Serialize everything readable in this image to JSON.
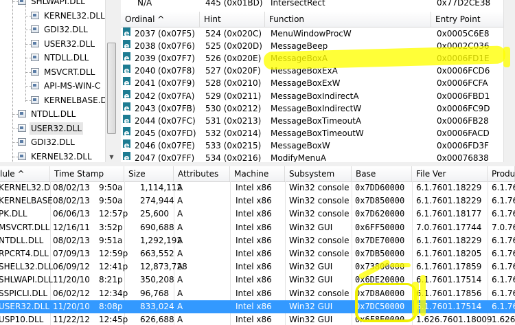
{
  "tree": {
    "nodes": [
      {
        "label": "SHLWAPI.DLL",
        "indent": 1
      },
      {
        "label": "KERNEL32.DLL",
        "indent": 2
      },
      {
        "label": "GDI32.DLL",
        "indent": 2
      },
      {
        "label": "USER32.DLL",
        "indent": 2
      },
      {
        "label": "NTDLL.DLL",
        "indent": 2
      },
      {
        "label": "MSVCRT.DLL",
        "indent": 2
      },
      {
        "label": "API-MS-WIN-C",
        "indent": 2
      },
      {
        "label": "KERNELBASE.D",
        "indent": 2
      },
      {
        "label": "NTDLL.DLL",
        "indent": 1
      },
      {
        "label": "USER32.DLL",
        "indent": 1,
        "selected": true
      },
      {
        "label": "GDI32.DLL",
        "indent": 1
      },
      {
        "label": "KERNEL32.DLL",
        "indent": 1
      }
    ]
  },
  "exports": {
    "top_row": {
      "ordinal": "N/A",
      "hint": "445 (0x01BD)",
      "function": "IntersectRect",
      "entry": "0x77D2CE38"
    },
    "columns": [
      "Ordinal ^",
      "Hint",
      "Function",
      "Entry Point"
    ],
    "rows": [
      {
        "ordinal": "2037",
        "ordinal_hex": "(0x07F5)",
        "hint": "524 (0x020C)",
        "function": "MenuWindowProcW",
        "entry": "0x0005C6E8"
      },
      {
        "ordinal": "2038",
        "ordinal_hex": "(0x07F6)",
        "hint": "525 (0x020D)",
        "function": "MessageBeep",
        "entry": "0x0002C036"
      },
      {
        "ordinal": "2039",
        "ordinal_hex": "(0x07F7)",
        "hint": "526 (0x020E)",
        "function": "MessageBoxA",
        "entry": "0x0006FD1E"
      },
      {
        "ordinal": "2040",
        "ordinal_hex": "(0x07F8)",
        "hint": "527 (0x020F)",
        "function": "MessageBoxExA",
        "entry": "0x0006FCD6"
      },
      {
        "ordinal": "2041",
        "ordinal_hex": "(0x07F9)",
        "hint": "528 (0x0210)",
        "function": "MessageBoxExW",
        "entry": "0x0006FCFA"
      },
      {
        "ordinal": "2042",
        "ordinal_hex": "(0x07FA)",
        "hint": "529 (0x0211)",
        "function": "MessageBoxIndirectA",
        "entry": "0x0006FBD1"
      },
      {
        "ordinal": "2043",
        "ordinal_hex": "(0x07FB)",
        "hint": "530 (0x0212)",
        "function": "MessageBoxIndirectW",
        "entry": "0x0006FC9D"
      },
      {
        "ordinal": "2044",
        "ordinal_hex": "(0x07FC)",
        "hint": "531 (0x0213)",
        "function": "MessageBoxTimeoutA",
        "entry": "0x0006FB28"
      },
      {
        "ordinal": "2045",
        "ordinal_hex": "(0x07FD)",
        "hint": "532 (0x0214)",
        "function": "MessageBoxTimeoutW",
        "entry": "0x0006FACD"
      },
      {
        "ordinal": "2046",
        "ordinal_hex": "(0x07FE)",
        "hint": "533 (0x0215)",
        "function": "MessageBoxW",
        "entry": "0x0006FD3F"
      },
      {
        "ordinal": "2047",
        "ordinal_hex": "(0x07FF)",
        "hint": "534 (0x0216)",
        "function": "ModifyMenuA",
        "entry": "0x00076838"
      }
    ]
  },
  "modules": {
    "columns": [
      "lule ^",
      "Time Stamp",
      "Size",
      "Attributes",
      "Machine",
      "Subsystem",
      "Base",
      "File Ver",
      "Produ"
    ],
    "rows": [
      {
        "module": "KERNEL32.D",
        "date": "08/02/13",
        "time": "9:50a",
        "size": "1,114,112",
        "attr": "A",
        "machine": "Intel x86",
        "subsystem": "Win32 console",
        "base": "0x7DD60000",
        "filever": "6.1.7601.18229",
        "prod": "6.1.76"
      },
      {
        "module": "KERNELBASE",
        "date": "08/02/13",
        "time": "9:50a",
        "size": "274,944",
        "attr": "A",
        "machine": "Intel x86",
        "subsystem": "Win32 console",
        "base": "0x7D850000",
        "filever": "6.1.7601.18229",
        "prod": "6.1.76"
      },
      {
        "module": "PK.DLL",
        "date": "06/06/13",
        "time": "12:57p",
        "size": "25,600",
        "attr": "A",
        "machine": "Intel x86",
        "subsystem": "Win32 console",
        "base": "0x7D620000",
        "filever": "6.1.7601.18177",
        "prod": "6.1.76"
      },
      {
        "module": "MSVCRT.DLL",
        "date": "12/16/11",
        "time": "3:52p",
        "size": "690,688",
        "attr": "A",
        "machine": "Intel x86",
        "subsystem": "Win32 GUI",
        "base": "0x6FF50000",
        "filever": "7.0.7601.17744",
        "prod": "7.0.76"
      },
      {
        "module": "NTDLL.DLL",
        "date": "08/02/13",
        "time": "9:51a",
        "size": "1,292,192",
        "attr": "A",
        "machine": "Intel x86",
        "subsystem": "Win32 console",
        "base": "0x7DE70000",
        "filever": "6.1.7601.18229",
        "prod": "6.1.76"
      },
      {
        "module": "RPCRT4.DLL",
        "date": "07/09/13",
        "time": "12:59p",
        "size": "663,552",
        "attr": "A",
        "machine": "Intel x86",
        "subsystem": "Win32 console",
        "base": "0x7DB50000",
        "filever": "6.1.7601.18205",
        "prod": "6.1.76"
      },
      {
        "module": "SHELL32.DLL",
        "date": "06/09/12",
        "time": "12:41p",
        "size": "12,873,728",
        "attr": "A",
        "machine": "Intel x86",
        "subsystem": "Win32 GUI",
        "base": "0x73800000",
        "filever": "6.1.7601.17859",
        "prod": "6.1.76"
      },
      {
        "module": "SHLWAPI.DLL",
        "date": "11/20/10",
        "time": "8:21p",
        "size": "350,208",
        "attr": "A",
        "machine": "Intel x86",
        "subsystem": "Win32 GUI",
        "base": "0x6DE20000",
        "filever": "6.1.7601.17514",
        "prod": "6.1.76"
      },
      {
        "module": "SSPICLI.DLL",
        "date": "06/02/12",
        "time": "12:34p",
        "size": "96,768",
        "attr": "A",
        "machine": "Intel x86",
        "subsystem": "Win32 console",
        "base": "0x7D8A0000",
        "filever": "6.1.7601.17856",
        "prod": "6.1.76"
      },
      {
        "module": "USER32.DLL",
        "date": "11/20/10",
        "time": "8:08p",
        "size": "833,024",
        "attr": "A",
        "machine": "Intel x86",
        "subsystem": "Win32 GUI",
        "base": "0x7DC50000",
        "filever": "6.1.7601.17514",
        "prod": "6.1.76",
        "selected": true
      },
      {
        "module": "USP10.DLL",
        "date": "11/22/12",
        "time": "12:45p",
        "size": "626,688",
        "attr": "A",
        "machine": "Intel x86",
        "subsystem": "Win32 GUI",
        "base": "0x6F8E0000",
        "filever": "1.626.7601.18009",
        "prod": "1.626."
      }
    ]
  },
  "colors": {
    "selection": "#3399ff",
    "highlighter": "#ffff00",
    "export_icon": "#1d7c92"
  }
}
